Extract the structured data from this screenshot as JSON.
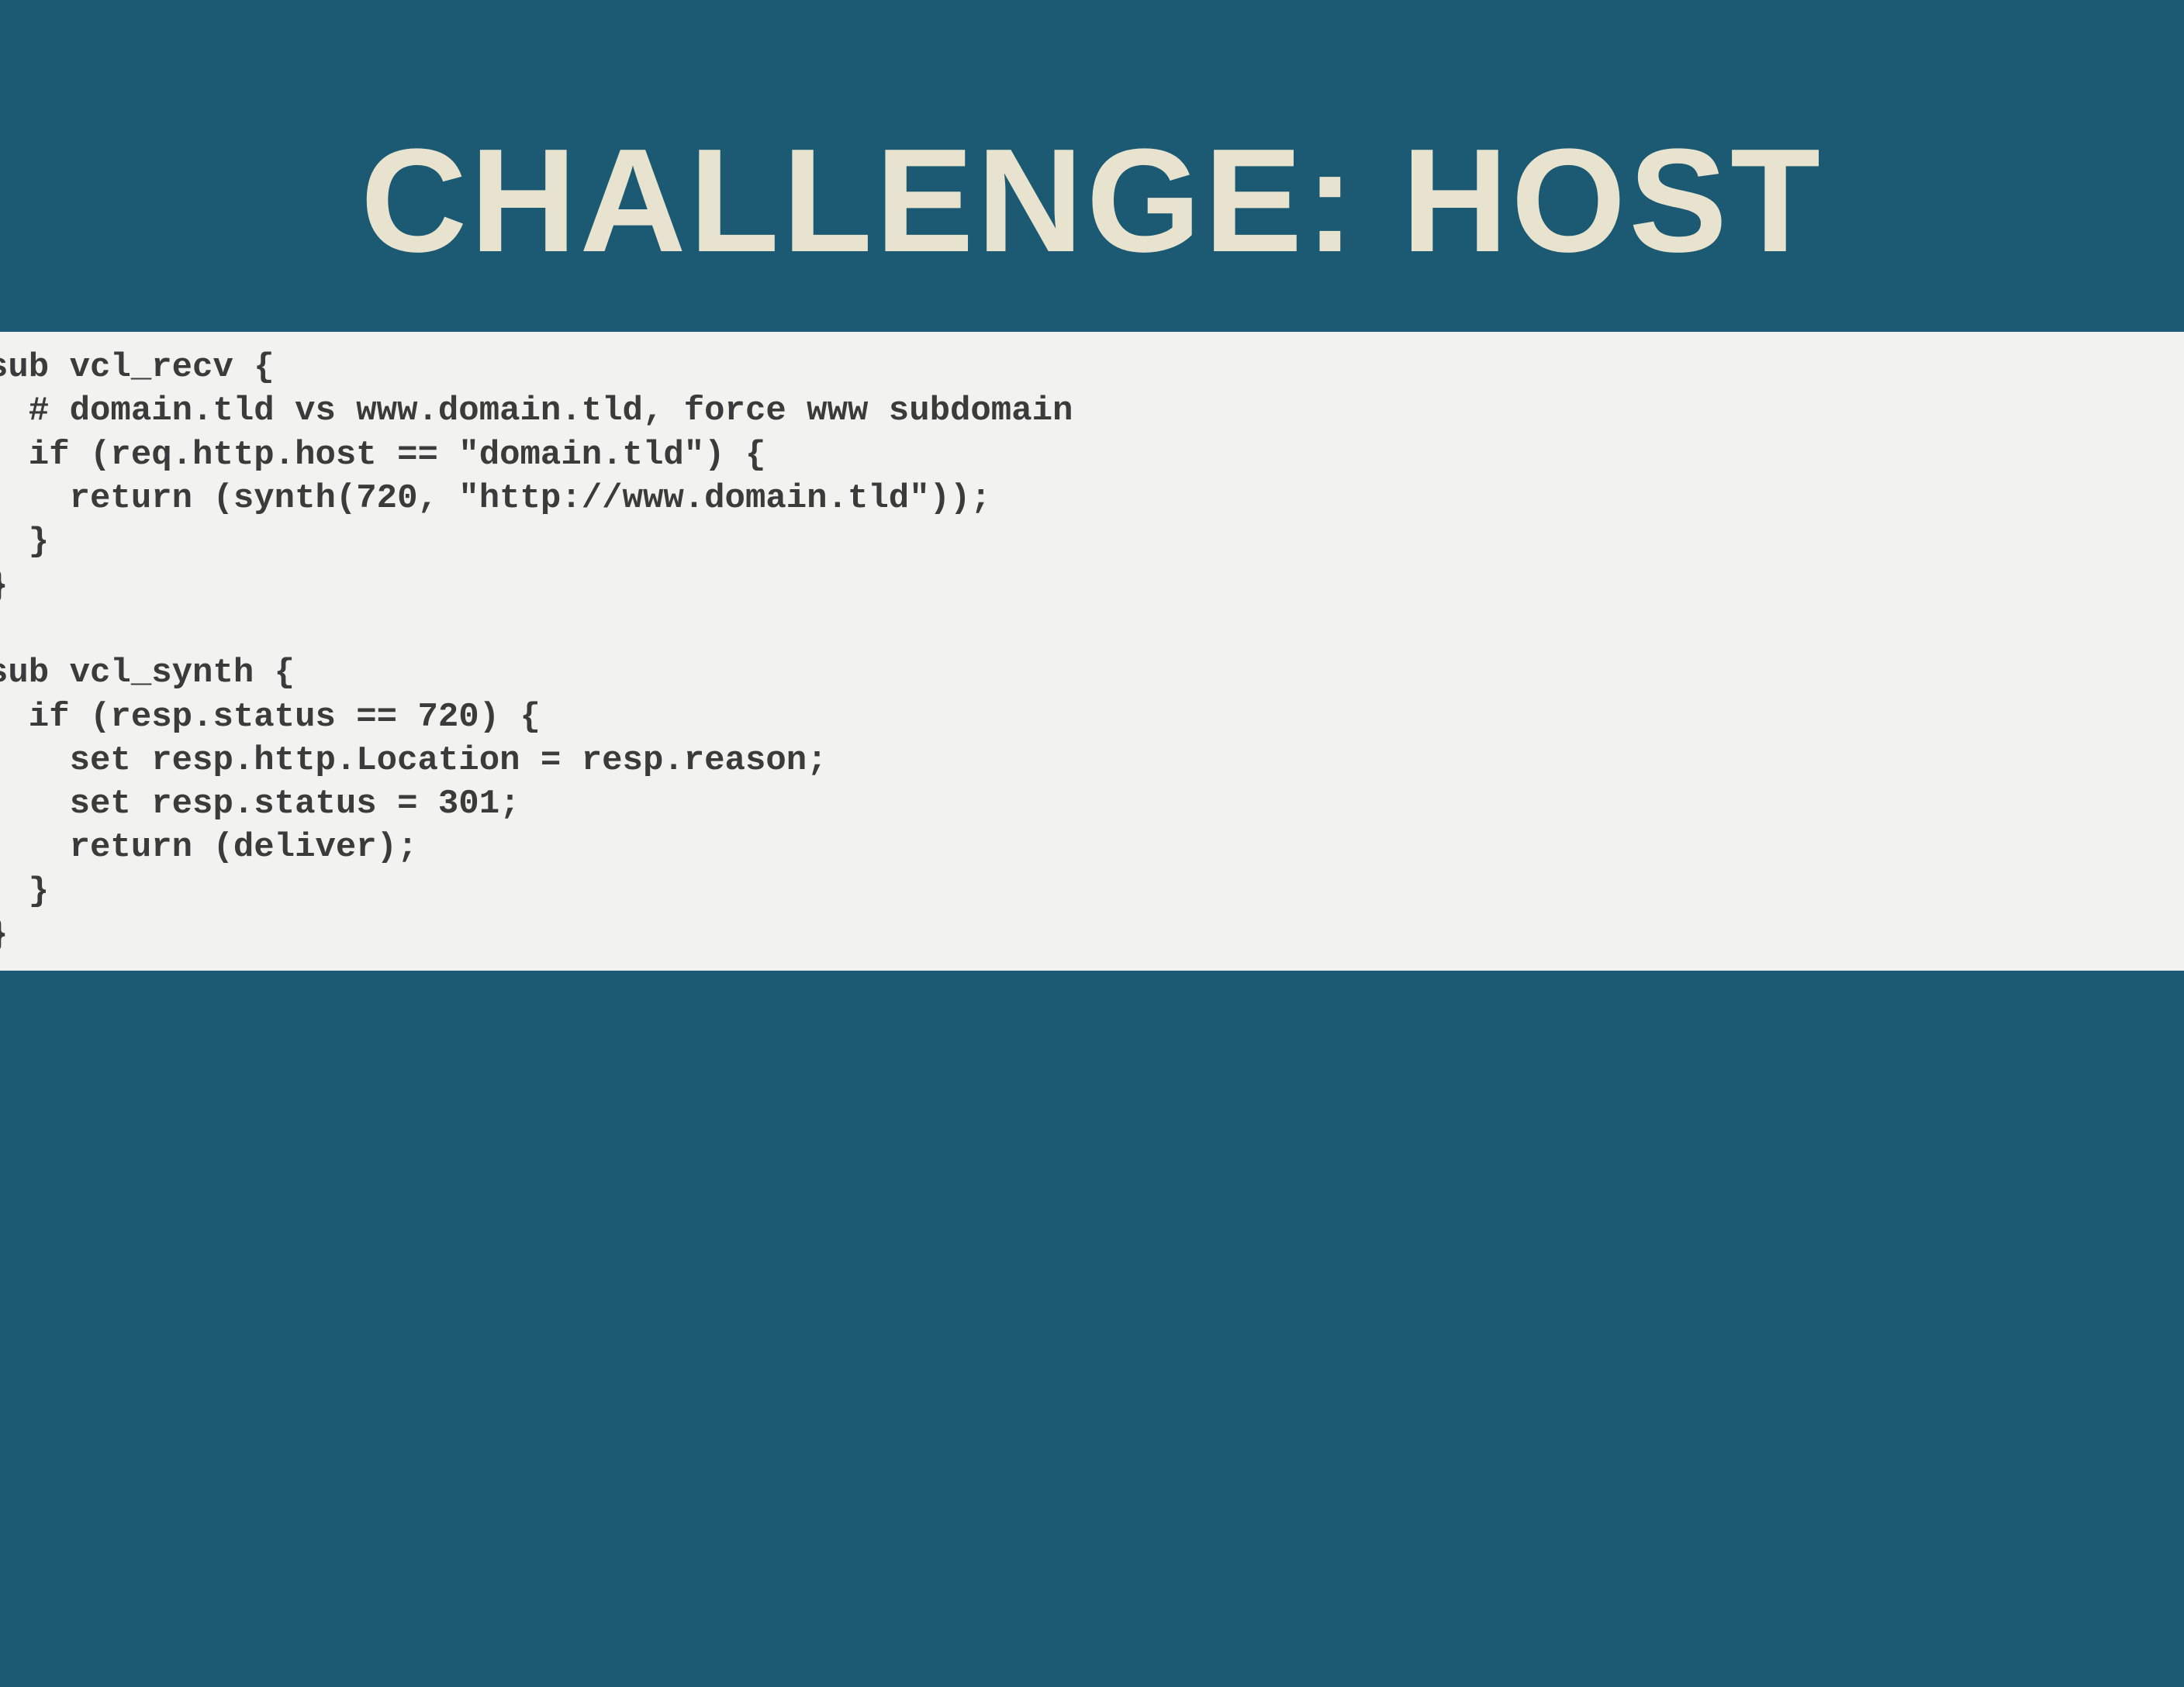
{
  "slide": {
    "title": "CHALLENGE: HOST",
    "code": "sub vcl_recv {\n  # domain.tld vs www.domain.tld, force www subdomain\n  if (req.http.host == \"domain.tld\") {\n    return (synth(720, \"http://www.domain.tld\"));\n  }\n}\n\nsub vcl_synth {\n  if (resp.status == 720) {\n    set resp.http.Location = resp.reason;\n    set resp.status = 301;\n    return (deliver);\n  }\n}"
  },
  "colors": {
    "background": "#1b5a72",
    "title": "#e8e3ce",
    "code_bg": "#f2f2f0",
    "code_text": "#3b3b3b"
  }
}
